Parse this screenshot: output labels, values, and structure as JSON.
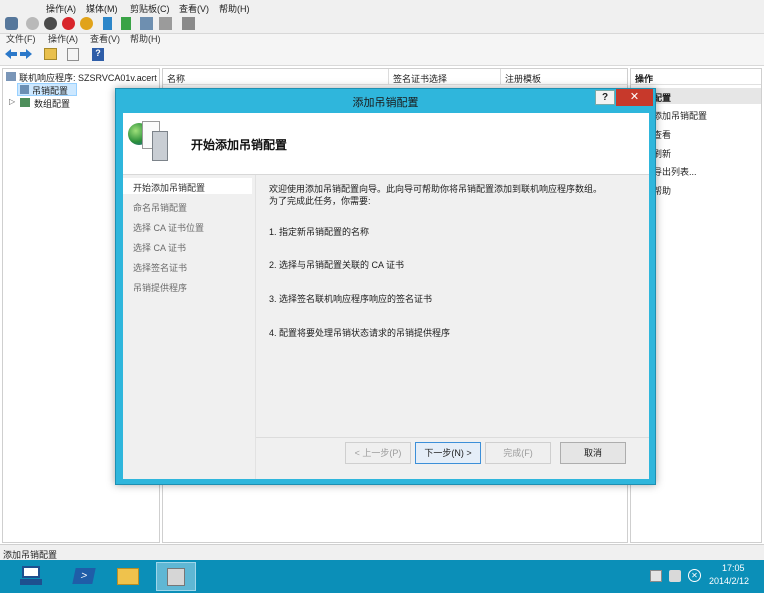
{
  "vm": {
    "menu": [
      "操作(A)",
      "媒体(M)",
      "剪贴板(C)",
      "查看(V)",
      "帮助(H)"
    ]
  },
  "mmc": {
    "menu": [
      "文件(F)",
      "操作(A)",
      "查看(V)",
      "帮助(H)"
    ],
    "tree": {
      "root": "联机响应程序: SZSRVCA01v.acert",
      "child1": "吊销配置",
      "child2": "数组配置"
    },
    "columns": [
      "名称",
      "签名证书选择",
      "注册模板"
    ],
    "actions": {
      "header": "操作",
      "section": "吊销配置",
      "items": [
        "添加吊销配置",
        "查看",
        "刷新",
        "导出列表...",
        "帮助"
      ]
    },
    "status": "添加吊销配置"
  },
  "dialog": {
    "title": "添加吊销配置",
    "help": "?",
    "close": "✕",
    "heading": "开始添加吊销配置",
    "steps": [
      "开始添加吊销配置",
      "命名吊销配置",
      "选择 CA 证书位置",
      "选择 CA 证书",
      "选择签名证书",
      "吊销提供程序"
    ],
    "intro1": "欢迎使用添加吊销配置向导。此向导可帮助你将吊销配置添加到联机响应程序数组。",
    "intro2": "为了完成此任务，你需要:",
    "items": [
      "1. 指定新吊销配置的名称",
      "2. 选择与吊销配置关联的 CA 证书",
      "3. 选择签名联机响应程序响应的签名证书",
      "4. 配置将要处理吊销状态请求的吊销提供程序"
    ],
    "buttons": {
      "back": "< 上一步(P)",
      "next": "下一步(N) >",
      "finish": "完成(F)",
      "cancel": "取消"
    }
  },
  "clock": {
    "time": "17:05",
    "date": "2014/2/12"
  }
}
